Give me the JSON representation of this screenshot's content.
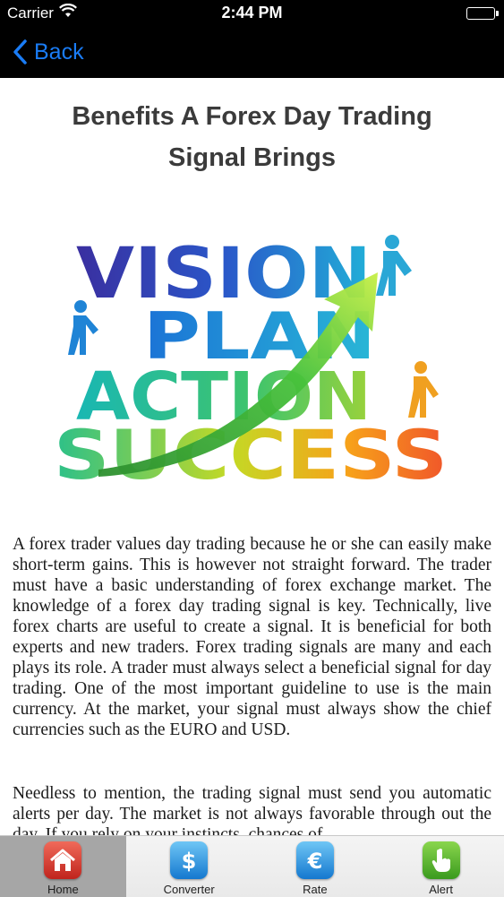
{
  "status_bar": {
    "carrier": "Carrier",
    "time": "2:44 PM"
  },
  "nav": {
    "back_label": "Back"
  },
  "article": {
    "title": "Benefits A Forex Day Trading Signal Brings",
    "hero_words": [
      "VISION",
      "PLAN",
      "ACTION",
      "SUCCESS"
    ],
    "paragraphs": [
      "A forex trader values day trading because he or she can easily make short-term gains. This is however not straight forward. The trader must have a basic understanding of forex exchange market. The knowledge of a forex day trading signal is key. Technically, live forex charts are useful to create a signal. It is beneficial for both experts and new traders. Forex trading signals are many and each plays its role. A trader must always select a beneficial signal for day trading. One of the most important guideline to use is the main currency. At the market, your signal must always show the chief currencies such as the EURO and USD.",
      "Needless to mention, the trading signal must send you automatic alerts per day. The market is not always favorable through out the day. If you rely on your instincts, chances of"
    ]
  },
  "tabs": [
    {
      "label": "Home",
      "icon": "home-icon",
      "active": true
    },
    {
      "label": "Converter",
      "icon": "dollar-icon",
      "active": false
    },
    {
      "label": "Rate",
      "icon": "euro-icon",
      "active": false
    },
    {
      "label": "Alert",
      "icon": "hand-pointer-icon",
      "active": false
    }
  ],
  "colors": {
    "nav_bg": "#000000",
    "back_blue": "#1a7cf5",
    "tab_active_bg": "#a6a6a6"
  }
}
